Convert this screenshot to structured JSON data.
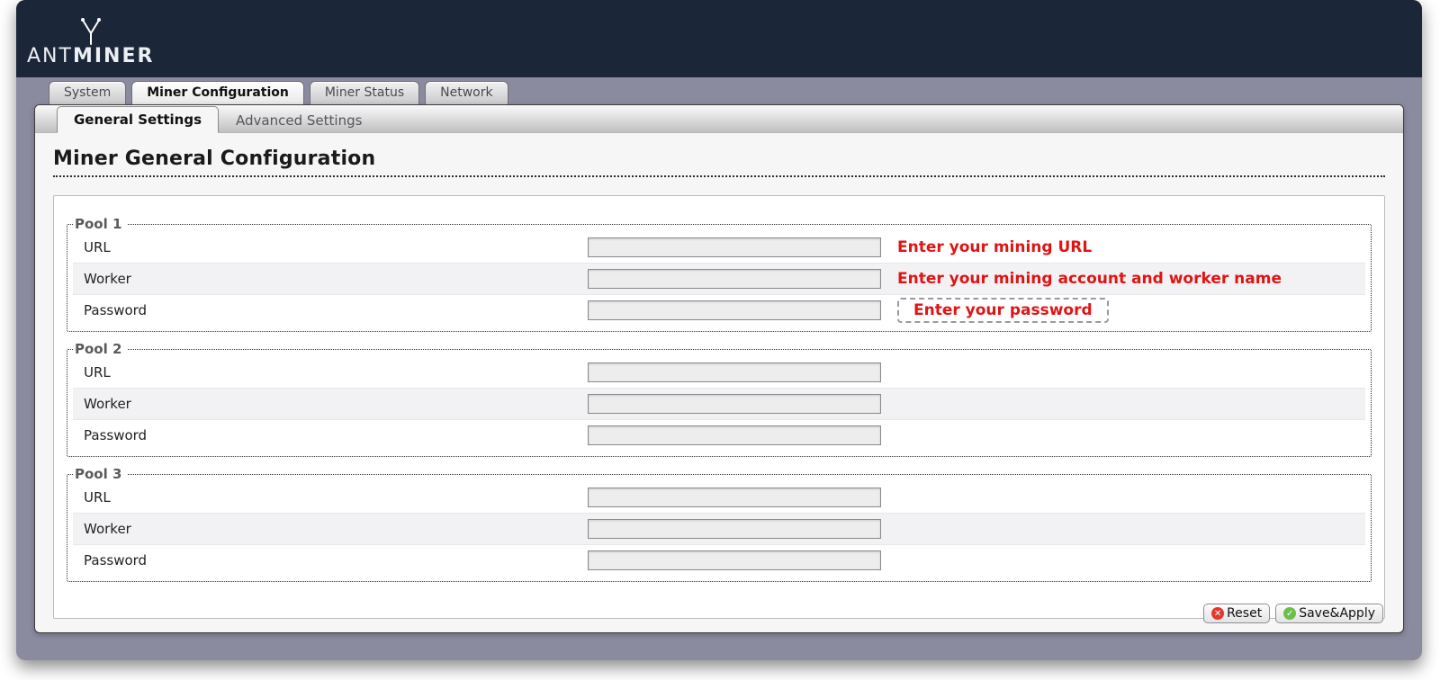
{
  "brand": {
    "line1": "ANT",
    "line2": "MINER"
  },
  "tabs": [
    "System",
    "Miner Configuration",
    "Miner Status",
    "Network"
  ],
  "active_tab_index": 1,
  "subtabs": [
    "General Settings",
    "Advanced Settings"
  ],
  "active_subtab_index": 0,
  "page_title": "Miner General Configuration",
  "field_labels": {
    "url": "URL",
    "worker": "Worker",
    "password": "Password"
  },
  "pools": [
    {
      "legend": "Pool 1",
      "url": "",
      "worker": "",
      "password": "",
      "hints": {
        "url": "Enter your mining URL",
        "worker": "Enter your mining account and worker name",
        "password": "Enter your password"
      }
    },
    {
      "legend": "Pool 2",
      "url": "",
      "worker": "",
      "password": "",
      "hints": {
        "url": "",
        "worker": "",
        "password": ""
      }
    },
    {
      "legend": "Pool 3",
      "url": "",
      "worker": "",
      "password": "",
      "hints": {
        "url": "",
        "worker": "",
        "password": ""
      }
    }
  ],
  "buttons": {
    "reset": "Reset",
    "save": "Save&Apply"
  },
  "colors": {
    "accent_red": "#e01414",
    "header_bg": "#1b2638",
    "frame_bg": "#8b8ba0"
  }
}
